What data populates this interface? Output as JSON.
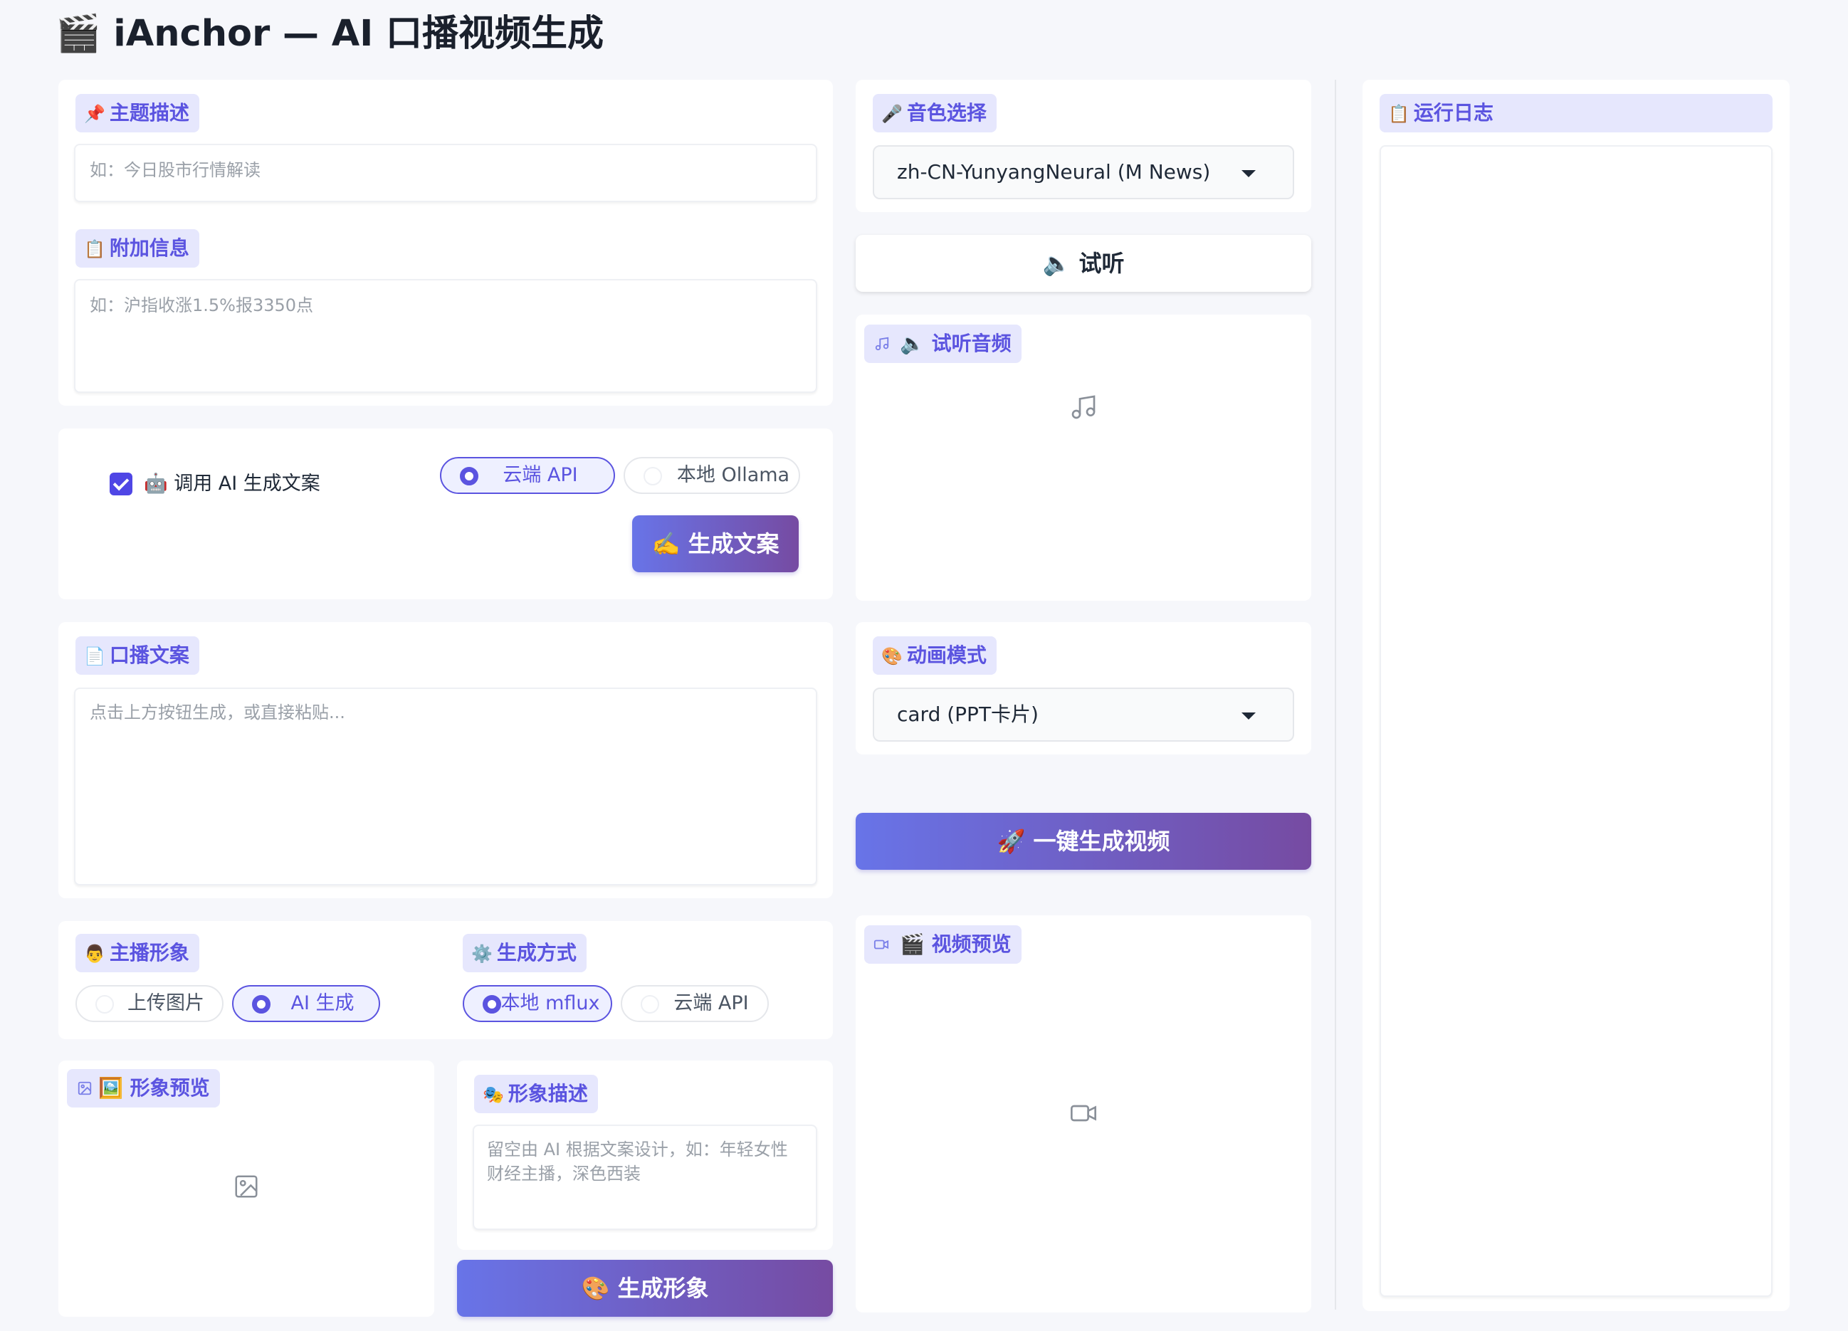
{
  "app": {
    "title": "🎬 iAnchor — AI 口播视频生成"
  },
  "topic": {
    "label": "主题描述",
    "icon": "📌",
    "placeholder": "如：今日股市行情解读"
  },
  "extra": {
    "label": "附加信息",
    "icon": "📋",
    "placeholder": "如：沪指收涨1.5%报3350点"
  },
  "ai_copy": {
    "checkbox_label": "🤖 调用 AI 生成文案",
    "checked": true,
    "options": [
      "云端 API",
      "本地 Ollama"
    ],
    "selected": "云端 API",
    "generate_button": "✍️ 生成文案"
  },
  "script": {
    "label": "口播文案",
    "icon": "📄",
    "placeholder": "点击上方按钮生成，或直接粘贴..."
  },
  "avatar": {
    "label": "主播形象",
    "icon": "👨",
    "options": [
      "上传图片",
      "AI 生成"
    ],
    "selected": "AI 生成"
  },
  "gen_method": {
    "label": "生成方式",
    "icon": "⚙️",
    "options": [
      "本地 mflux",
      "云端 API"
    ],
    "selected": "本地 mflux"
  },
  "avatar_preview": {
    "label": "🖼️ 形象预览",
    "label_icon": "image-icon"
  },
  "avatar_desc": {
    "label": "形象描述",
    "icon": "🎭",
    "placeholder": "留空由 AI 根据文案设计，如：年轻女性财经主播，深色西装",
    "button": "🎨 生成形象"
  },
  "voice": {
    "label": "音色选择",
    "icon": "🎤",
    "selected": "zh-CN-YunyangNeural (M News)",
    "preview_button": "🔈 试听"
  },
  "preview_audio": {
    "label": "🔈 试听音频",
    "label_icon": "music-note-icon"
  },
  "animation": {
    "label": "动画模式",
    "icon": "🎨",
    "selected": "card (PPT卡片)"
  },
  "generate_video": {
    "button": "🚀 一键生成视频"
  },
  "video_preview": {
    "label": "🎬 视频预览",
    "label_icon": "video-camera-icon"
  },
  "log": {
    "label": "运行日志",
    "icon": "📋"
  },
  "colors": {
    "accent": "#5b54e0",
    "chip_bg": "#e6e7fd",
    "gradient_start": "#6874e8",
    "gradient_end": "#764ba2"
  }
}
